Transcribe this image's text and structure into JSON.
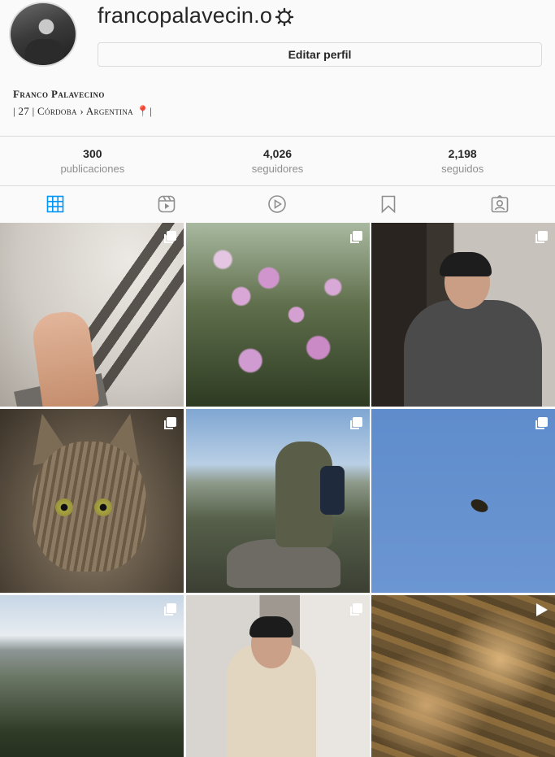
{
  "profile": {
    "username": "francopalavecin.o",
    "edit_label": "Editar perfil",
    "full_name": "Franco Palavecino",
    "bio": "| 27 | Córdoba › Argentina 📍|"
  },
  "stats": [
    {
      "value": "300",
      "label": "publicaciones"
    },
    {
      "value": "4,026",
      "label": "seguidores"
    },
    {
      "value": "2,198",
      "label": "seguidos"
    }
  ],
  "tabs": [
    {
      "icon": "grid-icon",
      "active": true
    },
    {
      "icon": "reels-icon",
      "active": false
    },
    {
      "icon": "video-icon",
      "active": false
    },
    {
      "icon": "saved-icon",
      "active": false
    },
    {
      "icon": "tagged-icon",
      "active": false
    }
  ],
  "posts": [
    {
      "subject": "hand shadow",
      "badge": "carousel-icon"
    },
    {
      "subject": "pink blossoms",
      "badge": "carousel-icon"
    },
    {
      "subject": "man with cap",
      "badge": "carousel-icon"
    },
    {
      "subject": "tabby cat",
      "badge": "carousel-icon"
    },
    {
      "subject": "hiker on rock",
      "badge": "carousel-icon"
    },
    {
      "subject": "bird in sky",
      "badge": "carousel-icon"
    },
    {
      "subject": "mountain landscape",
      "badge": "carousel-icon"
    },
    {
      "subject": "woman portrait",
      "badge": "carousel-icon"
    },
    {
      "subject": "riverbed",
      "badge": "video-icon"
    }
  ],
  "colors": {
    "active_tab": "#0095f6",
    "inactive_icon": "#8e8e8e",
    "border": "#dbdbdb"
  }
}
